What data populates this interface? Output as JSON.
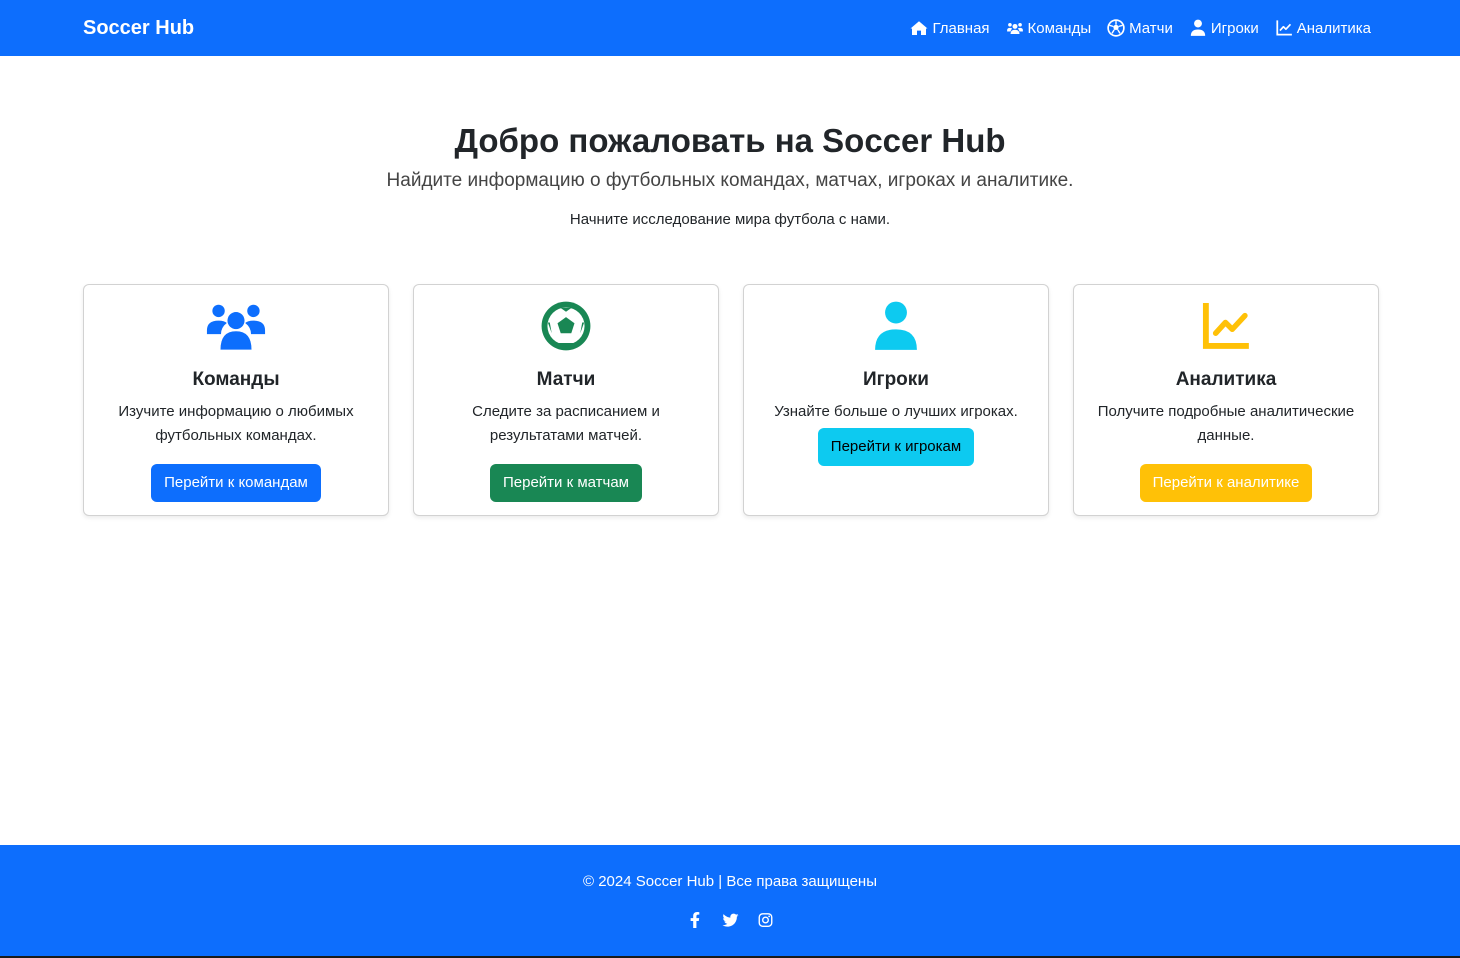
{
  "navbar": {
    "brand": "Soccer Hub",
    "links": [
      {
        "icon": "home-icon",
        "label": "Главная"
      },
      {
        "icon": "users-icon",
        "label": "Команды"
      },
      {
        "icon": "futbol-icon",
        "label": "Матчи"
      },
      {
        "icon": "user-icon",
        "label": "Игроки"
      },
      {
        "icon": "chart-line-icon",
        "label": "Аналитика"
      }
    ]
  },
  "hero": {
    "title": "Добро пожаловать на Soccer Hub",
    "lead": "Найдите информацию о футбольных командах, матчах, игроках и аналитике.",
    "sub": "Начните исследование мира футбола с нами."
  },
  "cards": [
    {
      "icon": "users-icon",
      "title": "Команды",
      "text": "Изучите информацию о любимых футбольных командах.",
      "button": "Перейти к командам",
      "color": "#0d6efd"
    },
    {
      "icon": "futbol-icon",
      "title": "Матчи",
      "text": "Следите за расписанием и результатами матчей.",
      "button": "Перейти к матчам",
      "color": "#198754"
    },
    {
      "icon": "user-icon",
      "title": "Игроки",
      "text": "Узнайте больше о лучших игроках.",
      "button": "Перейти к игрокам",
      "color": "#0dcaf0"
    },
    {
      "icon": "chart-line-icon",
      "title": "Аналитика",
      "text": "Получите подробные аналитические данные.",
      "button": "Перейти к аналитике",
      "color": "#ffc107"
    }
  ],
  "footer": {
    "copyright": "© 2024 Soccer Hub | Все права защищены",
    "socials": [
      "facebook-icon",
      "twitter-icon",
      "instagram-icon"
    ]
  }
}
